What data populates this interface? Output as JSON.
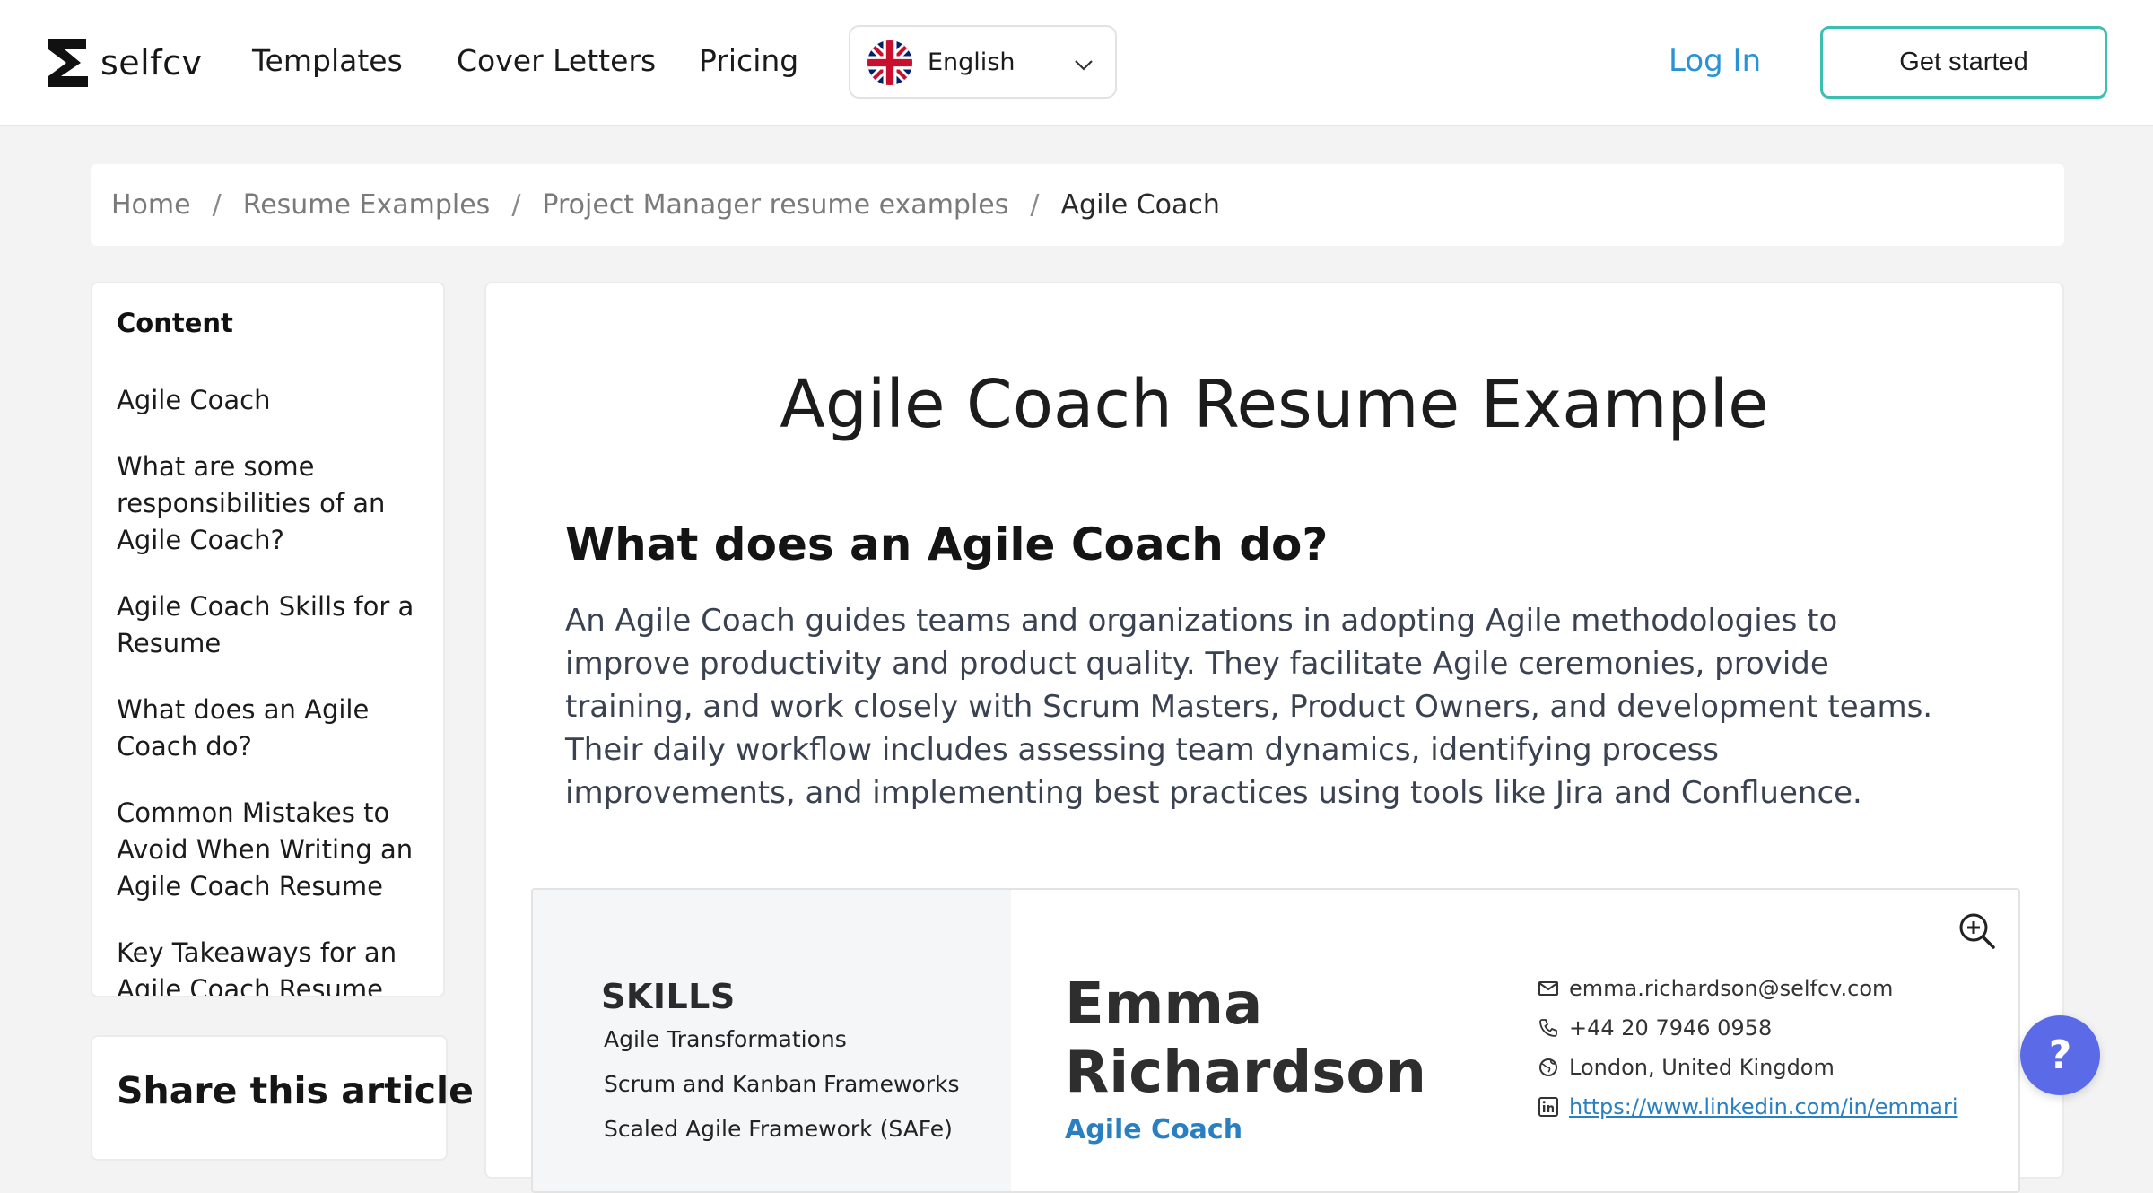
{
  "header": {
    "brand": "selfcv",
    "nav": [
      "Templates",
      "Cover Letters",
      "Pricing"
    ],
    "language": "English",
    "login_label": "Log In",
    "cta_label": "Get started"
  },
  "breadcrumb": [
    "Home",
    "Resume Examples",
    "Project Manager resume examples",
    "Agile Coach"
  ],
  "toc": {
    "title": "Content",
    "items": [
      "Agile Coach",
      "What are some responsibilities of an Agile Coach?",
      "Agile Coach Skills for a Resume",
      "What does an Agile Coach do?",
      "Common Mistakes to Avoid When Writing an Agile Coach Resume",
      "Key Takeaways for an Agile Coach Resume"
    ]
  },
  "share": {
    "title": "Share this article"
  },
  "main": {
    "title": "Agile Coach Resume Example",
    "section_heading": "What does an Agile Coach do?",
    "section_body": "An Agile Coach guides teams and organizations in adopting Agile methodologies to improve productivity and product quality. They facilitate Agile ceremonies, provide training, and work closely with Scrum Masters, Product Owners, and development teams. Their daily workflow includes assessing team dynamics, identifying process improvements, and implementing best practices using tools like Jira and Confluence."
  },
  "resume": {
    "skills_title": "SKILLS",
    "skills": [
      "Agile Transformations",
      "Scrum and Kanban Frameworks",
      "Scaled Agile Framework (SAFe)"
    ],
    "name_first": "Emma",
    "name_last": "Richardson",
    "role": "Agile Coach",
    "email": "emma.richardson@selfcv.com",
    "phone": "+44 20 7946 0958",
    "location": "London, United Kingdom",
    "linkedin": "https://www.linkedin.com/in/emmari"
  },
  "help_label": "?",
  "colors": {
    "accent_blue": "#2a93d5",
    "cta_border": "#3bbfb1",
    "help_bubble": "#5b6ae6",
    "resume_role": "#2a7fc0"
  },
  "icons": [
    "selfcv-logo-icon",
    "uk-flag-icon",
    "chevron-down-icon",
    "zoom-in-icon",
    "mail-icon",
    "phone-icon",
    "globe-icon",
    "linkedin-icon",
    "help-icon"
  ]
}
